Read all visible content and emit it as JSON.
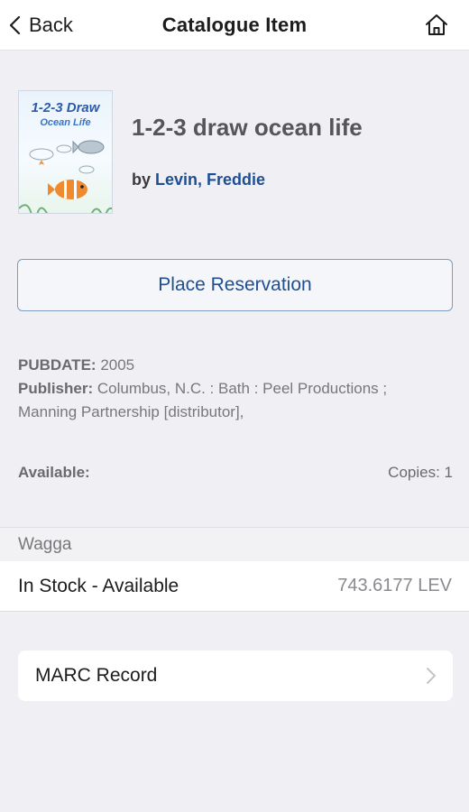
{
  "nav": {
    "back_label": "Back",
    "title": "Catalogue Item"
  },
  "item": {
    "cover": {
      "title_line1": "1-2-3 Draw",
      "title_line2": "Ocean Life"
    },
    "title": "1-2-3 draw ocean life",
    "by_prefix": "by",
    "author": "Levin, Freddie"
  },
  "reserve": {
    "label": "Place Reservation"
  },
  "meta": {
    "pubdate_label": "PUBDATE:",
    "pubdate_value": "2005",
    "publisher_label": "Publisher:",
    "publisher_value_line1": "Columbus, N.C. : Bath : Peel Productions ;",
    "publisher_value_line2": "Manning Partnership [distributor],"
  },
  "availability": {
    "label": "Available:",
    "copies": "Copies: 1"
  },
  "holdings": {
    "branch": "Wagga",
    "status": "In Stock - Available",
    "call_number": "743.6177 LEV"
  },
  "marc": {
    "label": "MARC Record"
  },
  "colors": {
    "link_blue": "#1f4f93",
    "background": "#efeff4"
  },
  "icons": [
    "chevron-left-icon",
    "home-icon",
    "chevron-right-icon"
  ]
}
